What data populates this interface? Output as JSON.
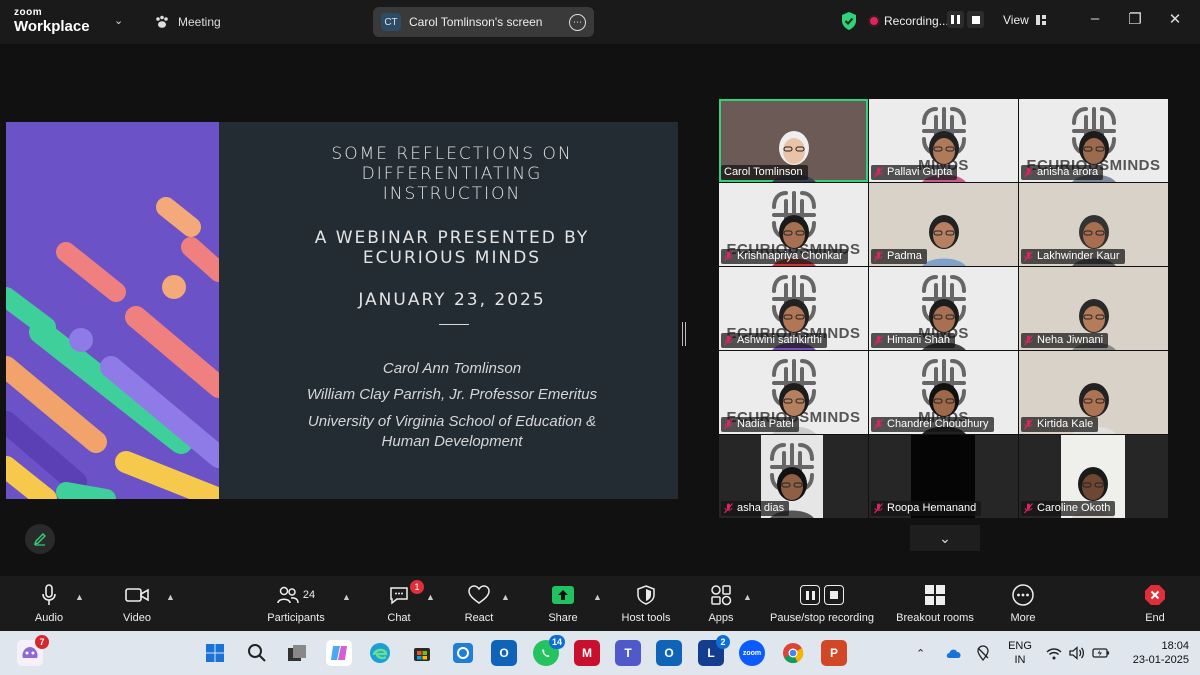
{
  "app": {
    "brand_line1": "zoom",
    "brand_line2": "Workplace"
  },
  "topbar": {
    "meeting_label": "Meeting",
    "screen_initials": "CT",
    "screen_label": "Carol Tomlinson's screen",
    "recording_label": "Recording...",
    "view_label": "View"
  },
  "slide": {
    "title": "SOME REFLECTIONS ON\nDIFFERENTIATING\nINSTRUCTION",
    "subtitle": "A WEBINAR PRESENTED BY\nECURIOUS MINDS",
    "date": "JANUARY 23, 2025",
    "presenter": "Carol Ann Tomlinson",
    "role": "William Clay Parrish, Jr. Professor Emeritus",
    "university": "University of Virginia School of Education &\nHuman Development"
  },
  "participants": [
    {
      "name": "Carol Tomlinson",
      "muted": false,
      "bg": "room",
      "active": true
    },
    {
      "name": "Pallavi Gupta",
      "muted": true,
      "bg": "logo",
      "active": false
    },
    {
      "name": "anisha arora",
      "muted": true,
      "bg": "logo",
      "active": false
    },
    {
      "name": "Krishnapriya Chonkar",
      "muted": true,
      "bg": "logo",
      "active": false
    },
    {
      "name": "Padma",
      "muted": true,
      "bg": "room",
      "active": false
    },
    {
      "name": "Lakhwinder Kaur",
      "muted": true,
      "bg": "room",
      "active": false
    },
    {
      "name": "Ashwini sathkirthi",
      "muted": true,
      "bg": "logo",
      "active": false
    },
    {
      "name": "Himani Shah",
      "muted": true,
      "bg": "logo",
      "active": false
    },
    {
      "name": "Neha Jiwnani",
      "muted": true,
      "bg": "room",
      "active": false
    },
    {
      "name": "Nadia Patel",
      "muted": true,
      "bg": "logo",
      "active": false
    },
    {
      "name": "Chandrei Choudhury",
      "muted": true,
      "bg": "logo",
      "active": false
    },
    {
      "name": "Kirtida Kale",
      "muted": true,
      "bg": "room",
      "active": false
    },
    {
      "name": "asha dias",
      "muted": true,
      "bg": "dark-logo",
      "active": false
    },
    {
      "name": "Roopa Hemanand",
      "muted": true,
      "bg": "dark",
      "active": false
    },
    {
      "name": "Caroline Okoth",
      "muted": true,
      "bg": "dark-room",
      "active": false
    }
  ],
  "logo_word_short": "MINDS",
  "logo_word_long": "ECURIOUSMINDS",
  "toolbar": {
    "audio": "Audio",
    "video": "Video",
    "participants": "Participants",
    "participants_count": "24",
    "chat": "Chat",
    "chat_badge": "1",
    "react": "React",
    "share": "Share",
    "host_tools": "Host tools",
    "apps": "Apps",
    "pause_stop": "Pause/stop recording",
    "breakout": "Breakout rooms",
    "more": "More",
    "end": "End"
  },
  "taskbar": {
    "copilot_badge": "7",
    "whatsapp_badge": "14",
    "l_badge": "2",
    "l_letter": "L",
    "zoom_letter": "zoom",
    "lang_line1": "ENG",
    "lang_line2": "IN",
    "time": "18:04",
    "date": "23-01-2025"
  },
  "colors": {
    "accent_green": "#2fd47a",
    "record_red": "#e0245e",
    "share_green": "#1fc35f",
    "end_red": "#e02f3a"
  }
}
